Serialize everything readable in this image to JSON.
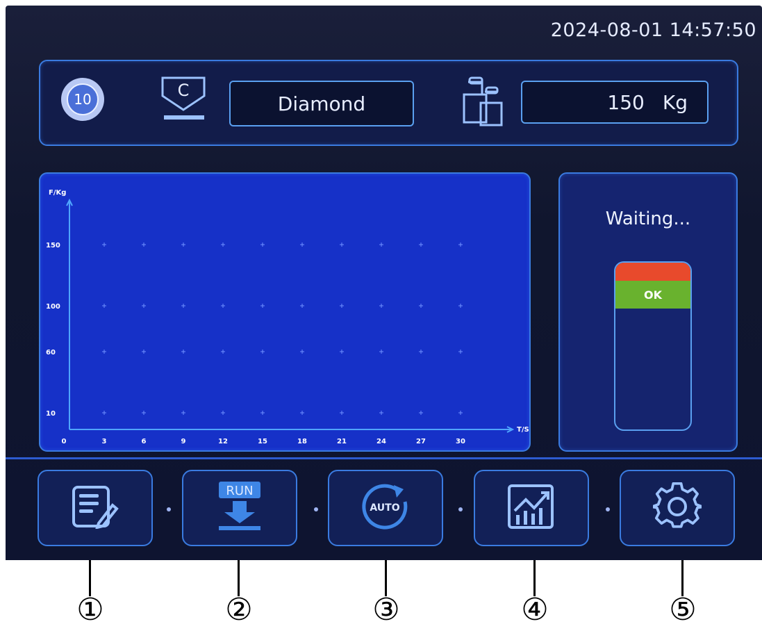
{
  "header": {
    "datetime": "2024-08-01 14:57:50"
  },
  "top_bar": {
    "dial_value": "10",
    "indenter_letter": "C",
    "material": "Diamond",
    "force_value": "150",
    "force_unit": "Kg"
  },
  "chart_data": {
    "type": "line",
    "ylabel": "F/Kg",
    "xlabel": "T/S",
    "y_ticks": [
      "10",
      "60",
      "100",
      "150"
    ],
    "x_ticks": [
      "0",
      "3",
      "6",
      "9",
      "12",
      "15",
      "18",
      "21",
      "24",
      "27",
      "30"
    ],
    "series": []
  },
  "status": {
    "text": "Waiting...",
    "ok_label": "OK",
    "red_color": "#e84a2c",
    "ok_color": "#69b22e"
  },
  "bottom_nav": {
    "items": [
      {
        "icon": "edit-notes-icon",
        "label": ""
      },
      {
        "icon": "run-download-icon",
        "label": "RUN"
      },
      {
        "icon": "auto-cycle-icon",
        "label": "AUTO"
      },
      {
        "icon": "chart-trend-icon",
        "label": ""
      },
      {
        "icon": "gear-icon",
        "label": ""
      }
    ]
  },
  "callouts": [
    "①",
    "②",
    "③",
    "④",
    "⑤"
  ],
  "colors": {
    "accent": "#3a7be0",
    "chart_bg": "#1631c8",
    "screen_bg": "#10162e"
  }
}
